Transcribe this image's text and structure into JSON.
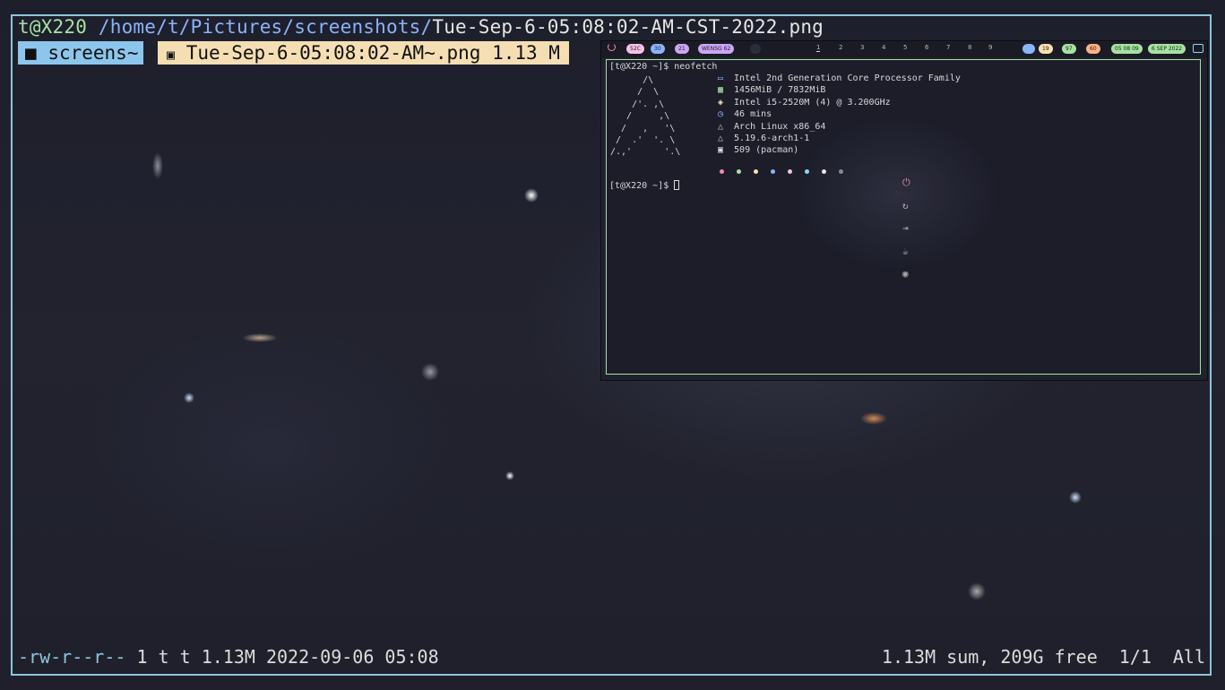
{
  "ranger": {
    "host": "t@X220",
    "path": "/home/t/Pictures/screenshots/",
    "file": "Tue-Sep-6-05:08:02-AM-CST-2022.png",
    "dir_tab": "screens~",
    "file_tab": "Tue-Sep-6-05:08:02-AM~.png",
    "file_size": "1.13 M",
    "status": {
      "permissions": "-rw-r--r--",
      "meta": "1 t t 1.13M 2022-09-06 05:08",
      "summary": "1.13M sum, 209G free",
      "position": "1/1",
      "scroll": "All"
    }
  },
  "embedded_desktop": {
    "bar": {
      "temp": "52C",
      "cpu": "30",
      "mem": "21",
      "wifi": "WENSG 62",
      "workspaces": [
        "1",
        "2",
        "3",
        "4",
        "5",
        "6",
        "7",
        "8",
        "9"
      ],
      "active_workspace": "1",
      "right_pills": [
        "19",
        "97",
        "60",
        "05 08 09",
        "6 SEP 2022"
      ]
    },
    "terminal": {
      "prompt1": "[t@X220 ~]$ neofetch",
      "logo": "      /\\\n     /  \\\n    /'. ,\\\n   /     ,\\\n  /   ,   '\\\n /  .'  '. \\\n/.,'      '.\\",
      "info": [
        {
          "icon": "monitor-icon",
          "glyph": "▭",
          "text": "Intel 2nd Generation Core Processor Family"
        },
        {
          "icon": "memory-icon",
          "glyph": "▦",
          "text": "1456MiB / 7832MiB"
        },
        {
          "icon": "cpu-icon",
          "glyph": "◈",
          "text": "Intel i5-2520M (4) @ 3.200GHz"
        },
        {
          "icon": "clock-icon",
          "glyph": "◷",
          "text": "46 mins"
        },
        {
          "icon": "arch-icon",
          "glyph": "△",
          "text": "Arch Linux x86_64"
        },
        {
          "icon": "kernel-icon",
          "glyph": "△",
          "text": "5.19.6-arch1-1"
        },
        {
          "icon": "package-icon",
          "glyph": "▣",
          "text": "509 (pacman)"
        }
      ],
      "palette": [
        "#f38ba8",
        "#a6e3a1",
        "#f9e2af",
        "#89b4fa",
        "#f5c2e7",
        "#89dceb",
        "#e6e6e6",
        "#8a8a8a"
      ],
      "prompt2": "[t@X220 ~]$ "
    }
  },
  "colors": {
    "frame": "#8cc6dc",
    "dir_tab_bg": "#8cc6ec",
    "file_tab_bg": "#f5deb3"
  }
}
